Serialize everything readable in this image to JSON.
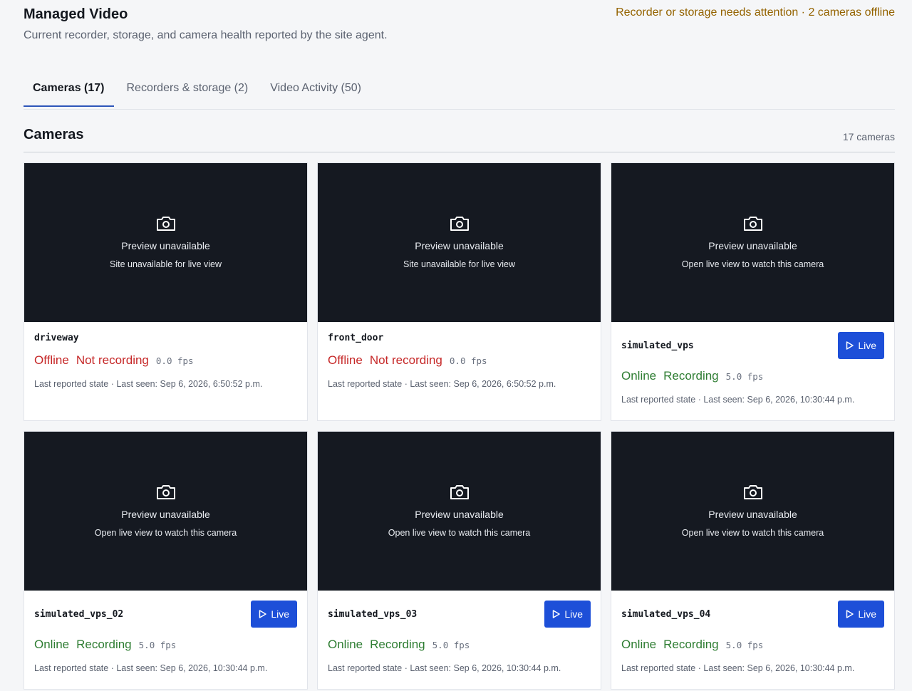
{
  "header": {
    "title": "Managed Video",
    "subtitle": "Current recorder, storage, and camera health reported by the site agent.",
    "attention": "Recorder or storage needs attention · 2 cameras offline"
  },
  "tabs": [
    {
      "label": "Cameras (17)",
      "active": true
    },
    {
      "label": "Recorders & storage (2)",
      "active": false
    },
    {
      "label": "Video Activity (50)",
      "active": false
    }
  ],
  "section": {
    "title": "Cameras",
    "count": "17 cameras"
  },
  "cameras": [
    {
      "name": "driveway",
      "preview_title": "Preview unavailable",
      "preview_sub": "Site unavailable for live view",
      "status": "Offline",
      "recording": "Not recording",
      "fps": "0.0 fps",
      "meta": "Last reported state · Last seen: Sep 6, 2026, 6:50:52 p.m.",
      "live_label": ""
    },
    {
      "name": "front_door",
      "preview_title": "Preview unavailable",
      "preview_sub": "Site unavailable for live view",
      "status": "Offline",
      "recording": "Not recording",
      "fps": "0.0 fps",
      "meta": "Last reported state · Last seen: Sep 6, 2026, 6:50:52 p.m.",
      "live_label": ""
    },
    {
      "name": "simulated_vps",
      "preview_title": "Preview unavailable",
      "preview_sub": "Open live view to watch this camera",
      "status": "Online",
      "recording": "Recording",
      "fps": "5.0 fps",
      "meta": "Last reported state · Last seen: Sep 6, 2026, 10:30:44 p.m.",
      "live_label": "Live"
    },
    {
      "name": "simulated_vps_02",
      "preview_title": "Preview unavailable",
      "preview_sub": "Open live view to watch this camera",
      "status": "Online",
      "recording": "Recording",
      "fps": "5.0 fps",
      "meta": "Last reported state · Last seen: Sep 6, 2026, 10:30:44 p.m.",
      "live_label": "Live"
    },
    {
      "name": "simulated_vps_03",
      "preview_title": "Preview unavailable",
      "preview_sub": "Open live view to watch this camera",
      "status": "Online",
      "recording": "Recording",
      "fps": "5.0 fps",
      "meta": "Last reported state · Last seen: Sep 6, 2026, 10:30:44 p.m.",
      "live_label": "Live"
    },
    {
      "name": "simulated_vps_04",
      "preview_title": "Preview unavailable",
      "preview_sub": "Open live view to watch this camera",
      "status": "Online",
      "recording": "Recording",
      "fps": "5.0 fps",
      "meta": "Last reported state · Last seen: Sep 6, 2026, 10:30:44 p.m.",
      "live_label": "Live"
    }
  ],
  "colors": {
    "accent": "#1d4fd8",
    "offline": "#c62828",
    "online": "#2e7d32",
    "attention": "#946300",
    "preview_bg": "#151921"
  },
  "icons": {
    "preview": "camera-icon",
    "live": "play-icon"
  }
}
